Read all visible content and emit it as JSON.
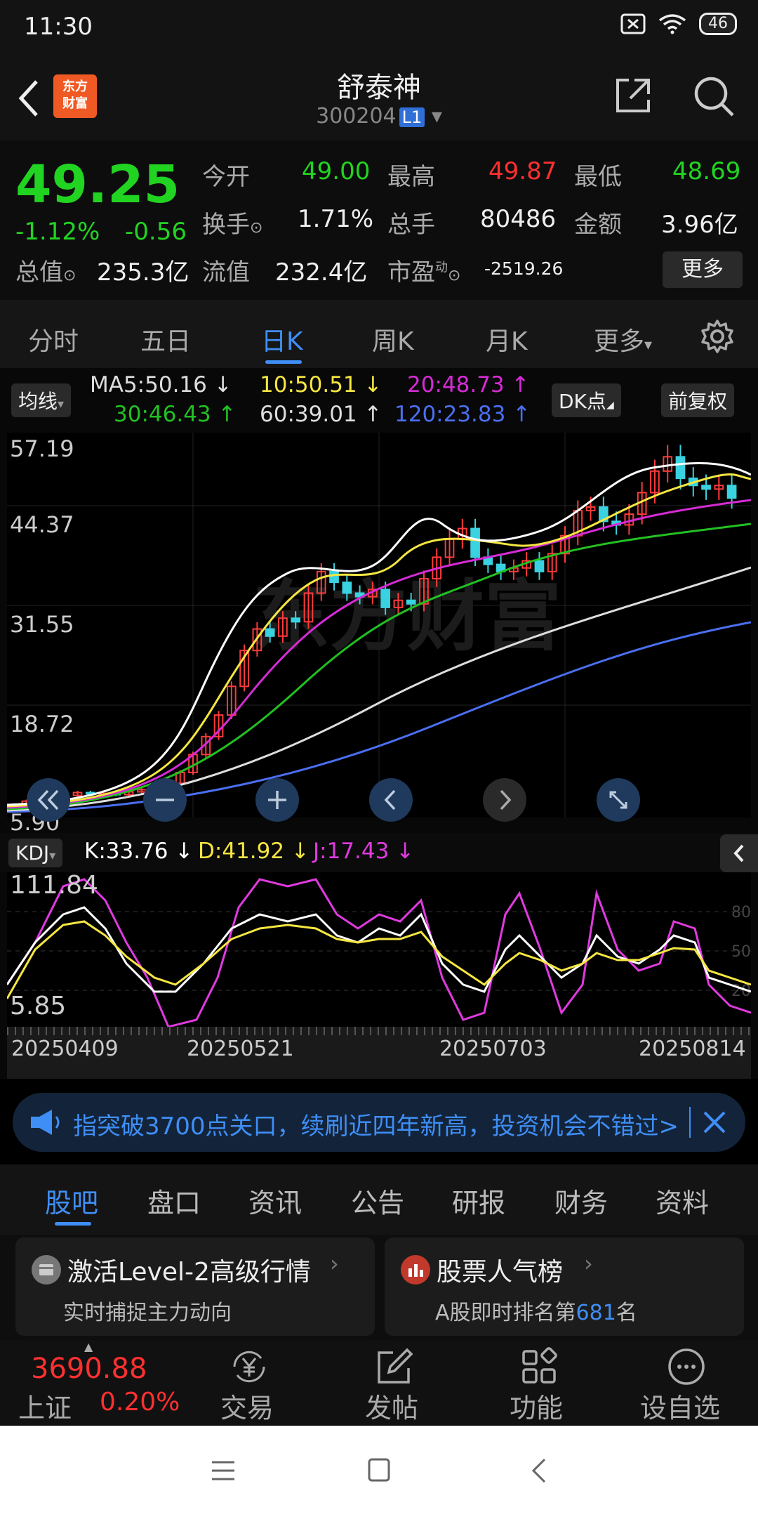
{
  "status_bar": {
    "time": "11:30",
    "battery": "46"
  },
  "header": {
    "logo_text_1": "东方",
    "logo_text_2": "财富",
    "stock_name": "舒泰神",
    "stock_code": "300204",
    "level_badge": "L1"
  },
  "quote": {
    "price": "49.25",
    "change_pct": "-1.12%",
    "change_abs": "-0.56",
    "fields": [
      {
        "label": "今开",
        "value": "49.00",
        "color": "#22d422"
      },
      {
        "label": "最高",
        "value": "49.87",
        "color": "#ff3030"
      },
      {
        "label": "最低",
        "value": "48.69",
        "color": "#22d422"
      },
      {
        "label": "换手",
        "value": "1.71%",
        "color": "#eeeeee"
      },
      {
        "label": "总手",
        "value": "80486",
        "color": "#eeeeee"
      },
      {
        "label": "金额",
        "value": "3.96亿",
        "color": "#eeeeee"
      },
      {
        "label": "总值",
        "value": "235.3亿",
        "color": "#eeeeee"
      },
      {
        "label": "流值",
        "value": "232.4亿",
        "color": "#eeeeee"
      },
      {
        "label": "市盈",
        "value": "-2519.26",
        "color": "#eeeeee"
      }
    ],
    "pe_superscript": "动",
    "more_label": "更多"
  },
  "period_tabs": {
    "items": [
      "分时",
      "五日",
      "日K",
      "周K",
      "月K",
      "更多"
    ],
    "active": "日K"
  },
  "ma_legend": {
    "selector": "均线",
    "items": [
      {
        "text": "MA5:50.16 ↓",
        "color": "#eeeeee"
      },
      {
        "text": "10:50.51 ↓",
        "color": "#f5e642"
      },
      {
        "text": "20:48.73 ↑",
        "color": "#d52bd5"
      },
      {
        "text": "30:46.43 ↑",
        "color": "#22c022"
      },
      {
        "text": "60:39.01 ↑",
        "color": "#dddddd"
      },
      {
        "text": "120:23.83 ↑",
        "color": "#4a6ff0"
      }
    ],
    "dk_label": "DK点",
    "adjust_label": "前复权"
  },
  "chart_data": [
    {
      "type": "candlestick",
      "title": "",
      "y_tick_labels": [
        "57.19",
        "44.37",
        "31.55",
        "18.72",
        "5.90"
      ],
      "ylim": [
        5.9,
        57.19
      ],
      "x_tick_labels": [
        "20250409",
        "20250521",
        "20250703",
        "20250814"
      ],
      "watermark": "东方财富",
      "close_approx": [
        6.5,
        7.0,
        7.5,
        7.4,
        7.8,
        8.2,
        8.0,
        8.1,
        7.9,
        8.3,
        8.6,
        8.8,
        9.5,
        11.0,
        13.5,
        16.0,
        19.0,
        23.0,
        28.0,
        31.0,
        30.0,
        32.5,
        32.0,
        36.0,
        39.0,
        37.5,
        36.0,
        35.5,
        36.5,
        34.0,
        35.0,
        34.5,
        38.0,
        41.0,
        43.5,
        45.0,
        41.0,
        40.0,
        39.0,
        39.5,
        40.5,
        39.0,
        41.5,
        44.0,
        47.5,
        48.0,
        46.0,
        45.5,
        47.0,
        50.0,
        53.0,
        55.0,
        52.0,
        51.0,
        50.5,
        51.0,
        49.25
      ]
    },
    {
      "type": "line",
      "title": "KDJ",
      "series": [
        {
          "name": "K:33.76 ↓",
          "color": "#ffffff"
        },
        {
          "name": "D:41.92 ↓",
          "color": "#f5e642"
        },
        {
          "name": "J:17.43 ↓",
          "color": "#e03ae0"
        }
      ],
      "y_tick_labels": [
        "111.84",
        "5.85"
      ],
      "ylim": [
        5.85,
        111.84
      ],
      "ref_lines": [
        "80",
        "50",
        "20"
      ]
    }
  ],
  "nav_buttons": [
    "double-left-icon",
    "zoom-out-icon",
    "zoom-in-icon",
    "prev-icon",
    "next-icon",
    "fullscreen-icon"
  ],
  "notice": {
    "text": "指突破3700点关口，续刷近四年新高，投资机会不错过>"
  },
  "news_tabs": {
    "items": [
      "股吧",
      "盘口",
      "资讯",
      "公告",
      "研报",
      "财务",
      "资料"
    ],
    "active": "股吧"
  },
  "cards": [
    {
      "title": "激活Level-2高级行情",
      "subtitle": "实时捕捉主力动向"
    },
    {
      "title": "股票人气榜",
      "subtitle_prefix": "A股即时排名第",
      "rank": "681",
      "subtitle_suffix": "名"
    }
  ],
  "bottom_bar": {
    "index_value": "3690.88",
    "index_name": "上证",
    "index_change": "0.20%",
    "items": [
      "交易",
      "发帖",
      "功能",
      "设自选"
    ]
  }
}
